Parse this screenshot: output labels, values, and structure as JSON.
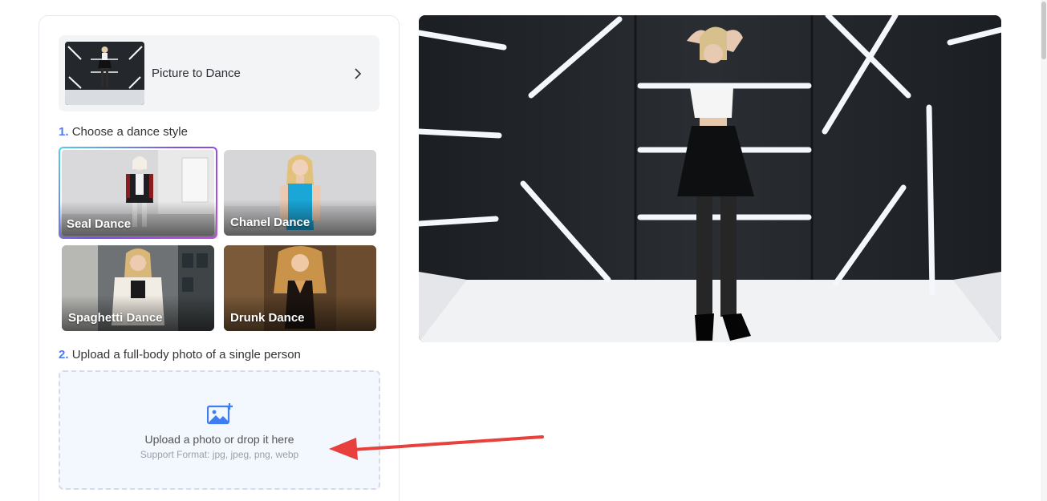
{
  "mode": {
    "label": "Picture to Dance"
  },
  "step1": {
    "num": "1.",
    "title": "Choose a dance style"
  },
  "styles": [
    {
      "name": "Seal Dance",
      "selected": true
    },
    {
      "name": "Chanel Dance",
      "selected": false
    },
    {
      "name": "Spaghetti Dance",
      "selected": false
    },
    {
      "name": "Drunk Dance",
      "selected": false
    }
  ],
  "step2": {
    "num": "2.",
    "title": "Upload a full-body photo of a single person"
  },
  "upload": {
    "main_text": "Upload a photo or drop it here",
    "support_text": "Support Format: jpg, jpeg, png, webp"
  },
  "colors": {
    "accent": "#4b7bf5",
    "arrow": "#e8403c",
    "upload_bg": "#f3f7fe"
  },
  "icons": {
    "mode_chevron": "chevron-right-icon",
    "upload": "image-add-icon"
  }
}
